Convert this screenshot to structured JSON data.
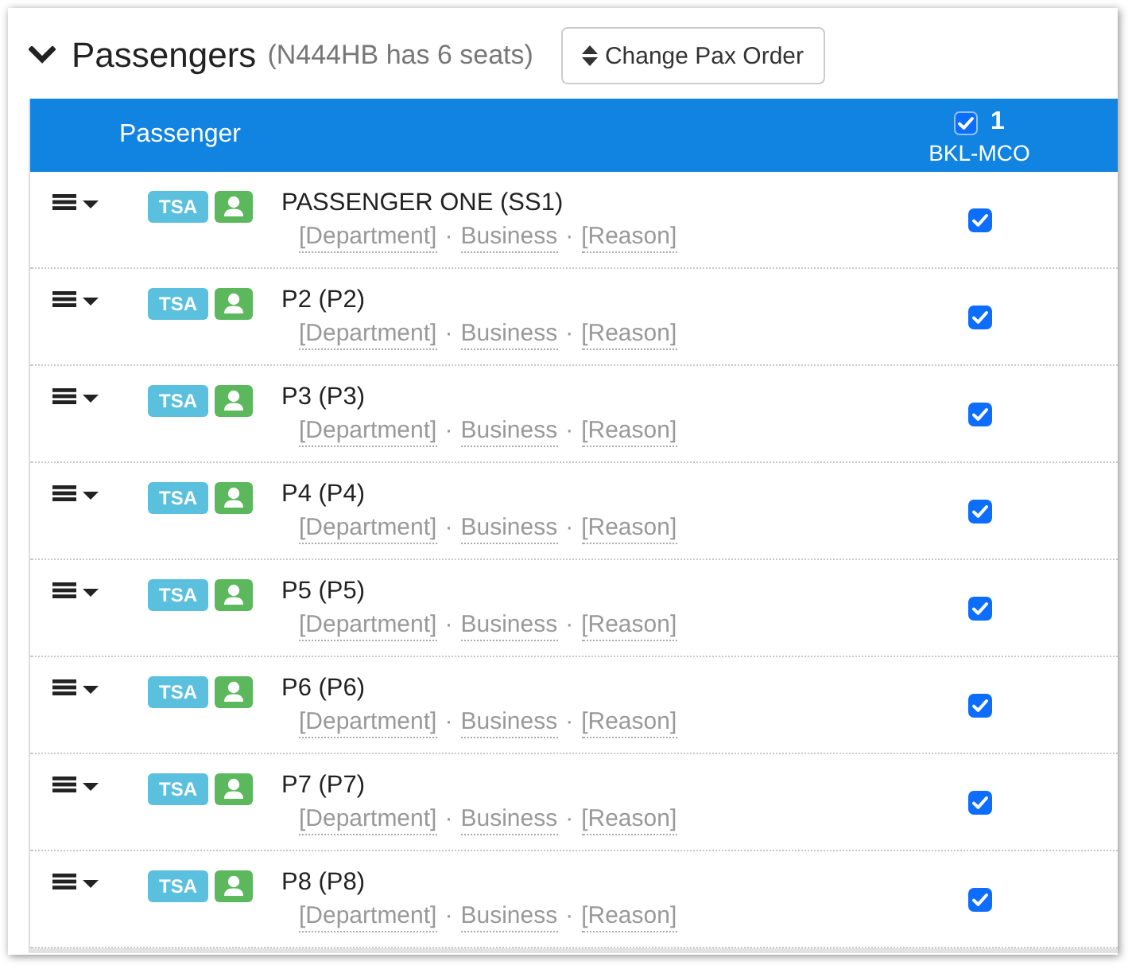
{
  "section": {
    "expanded": true,
    "title": "Passengers",
    "subtitle": "(N444HB has 6 seats)",
    "button": "Change Pax Order"
  },
  "table": {
    "header": "Passenger",
    "legs": [
      {
        "checked": true,
        "number": "1",
        "route": "BKL-MCO"
      }
    ],
    "separator": "·",
    "rows": [
      {
        "badge": "TSA",
        "name": "PASSENGER ONE (SS1)",
        "details": [
          "[Department]",
          "Business",
          "[Reason]"
        ],
        "legs": [
          {
            "checked": true
          }
        ]
      },
      {
        "badge": "TSA",
        "name": "P2 (P2)",
        "details": [
          "[Department]",
          "Business",
          "[Reason]"
        ],
        "legs": [
          {
            "checked": true
          }
        ]
      },
      {
        "badge": "TSA",
        "name": "P3 (P3)",
        "details": [
          "[Department]",
          "Business",
          "[Reason]"
        ],
        "legs": [
          {
            "checked": true
          }
        ]
      },
      {
        "badge": "TSA",
        "name": "P4 (P4)",
        "details": [
          "[Department]",
          "Business",
          "[Reason]"
        ],
        "legs": [
          {
            "checked": true
          }
        ]
      },
      {
        "badge": "TSA",
        "name": "P5 (P5)",
        "details": [
          "[Department]",
          "Business",
          "[Reason]"
        ],
        "legs": [
          {
            "checked": true
          }
        ]
      },
      {
        "badge": "TSA",
        "name": "P6 (P6)",
        "details": [
          "[Department]",
          "Business",
          "[Reason]"
        ],
        "legs": [
          {
            "checked": true
          }
        ]
      },
      {
        "badge": "TSA",
        "name": "P7 (P7)",
        "details": [
          "[Department]",
          "Business",
          "[Reason]"
        ],
        "legs": [
          {
            "checked": true
          }
        ]
      },
      {
        "badge": "TSA",
        "name": "P8 (P8)",
        "details": [
          "[Department]",
          "Business",
          "[Reason]"
        ],
        "legs": [
          {
            "checked": true
          }
        ]
      }
    ]
  }
}
